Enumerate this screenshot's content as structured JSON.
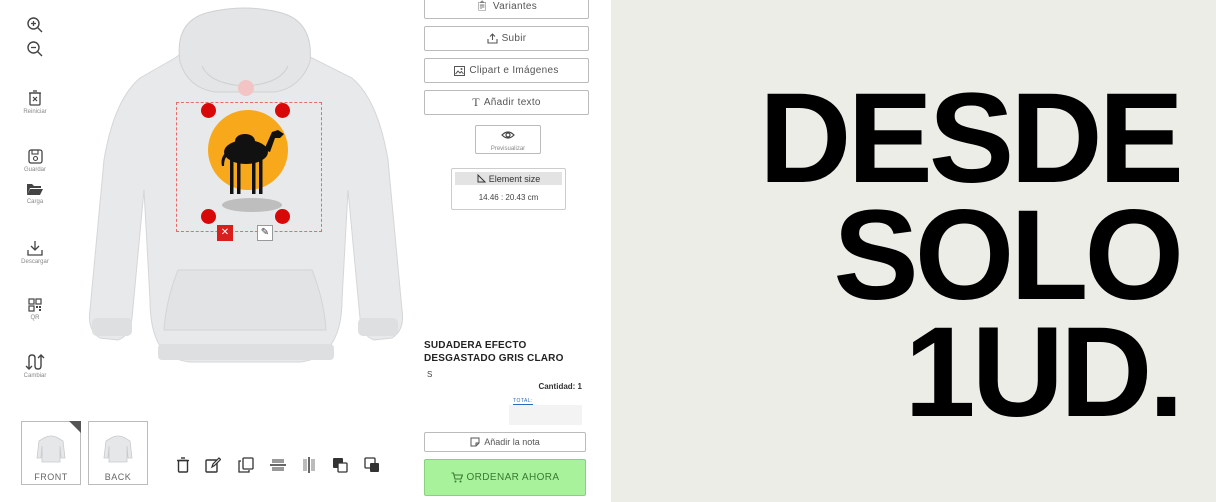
{
  "toolbar": {
    "reset_label": "Reiniciar",
    "save_label": "Guardar",
    "load_label": "Carga",
    "download_label": "Descargar",
    "qr_label": "QR",
    "change_label": "Cambiar"
  },
  "views": {
    "front_label": "FRONT",
    "back_label": "BACK"
  },
  "panel": {
    "variants_label": "Variantes",
    "upload_label": "Subir",
    "clipart_label": "Clipart e Imágenes",
    "add_text_label": "Añadir texto",
    "preview_label": "Previsualizar",
    "element_size_label": "Element size",
    "element_size_value": "14.46 : 20.43 cm"
  },
  "product": {
    "title": "SUDADERA EFECTO DESGASTADO GRIS CLARO",
    "size": "S",
    "quantity": "Cantidad: 1",
    "total_label": "TOTAL:",
    "note_label": "Añadir la nota",
    "order_label": "ORDENAR AHORA"
  },
  "banner": {
    "line1": "DESDE",
    "line2": "SOLO",
    "line3": "1UD."
  },
  "colors": {
    "handle": "#d90808",
    "order_button": "#a8f29c",
    "banner_bg": "#ebede6",
    "sun": "#f7a81b"
  }
}
